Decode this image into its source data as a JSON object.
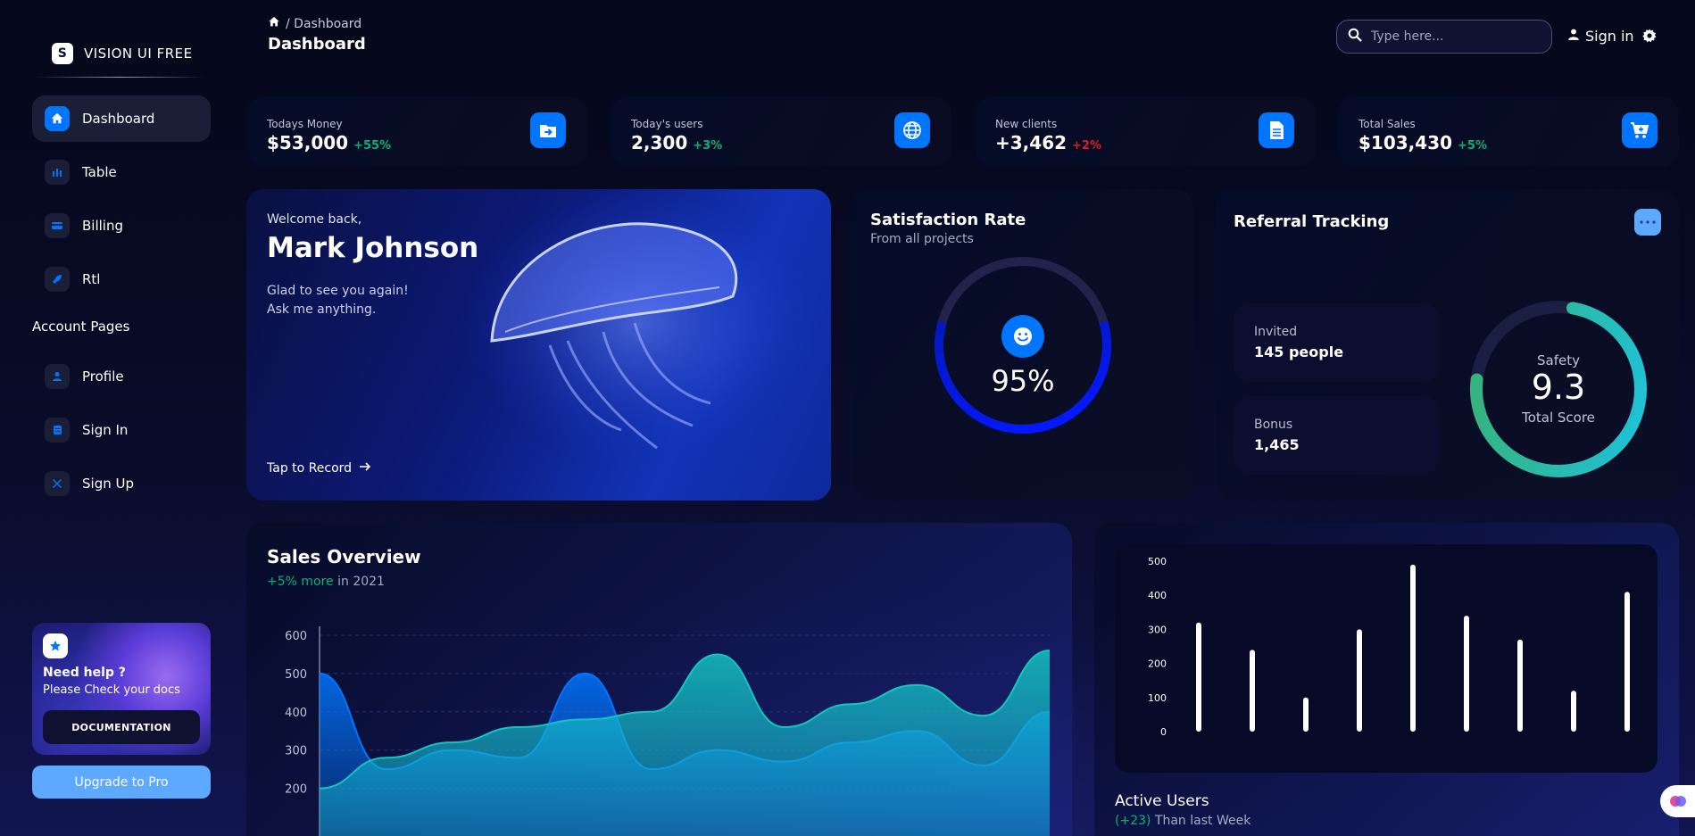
{
  "brand": {
    "name": "VISION UI FREE",
    "logo_letter": "S"
  },
  "sidebar": {
    "items": [
      {
        "label": "Dashboard",
        "icon": "home-icon",
        "active": true
      },
      {
        "label": "Table",
        "icon": "bar-chart-icon"
      },
      {
        "label": "Billing",
        "icon": "credit-card-icon"
      },
      {
        "label": "Rtl",
        "icon": "rocket-icon"
      }
    ],
    "section_title": "Account Pages",
    "account_items": [
      {
        "label": "Profile",
        "icon": "user-icon"
      },
      {
        "label": "Sign In",
        "icon": "document-icon"
      },
      {
        "label": "Sign Up",
        "icon": "tools-icon"
      }
    ],
    "help": {
      "title": "Need help ?",
      "subtitle": "Please Check your docs",
      "button": "DOCUMENTATION"
    },
    "upgrade": "Upgrade to Pro"
  },
  "header": {
    "breadcrumb": "/ Dashboard",
    "title": "Dashboard",
    "search_placeholder": "Type here...",
    "signin": "Sign in"
  },
  "stats": [
    {
      "label": "Todays Money",
      "value": "$53,000",
      "change": "+55%",
      "change_color": "#01b574",
      "icon": "wallet-icon"
    },
    {
      "label": "Today's users",
      "value": "2,300",
      "change": "+3%",
      "change_color": "#01b574",
      "icon": "globe-icon"
    },
    {
      "label": "New clients",
      "value": "+3,462",
      "change": "+2%",
      "change_color": "#e31a1a",
      "icon": "document-icon"
    },
    {
      "label": "Total Sales",
      "value": "$103,430",
      "change": "+5%",
      "change_color": "#01b574",
      "icon": "cart-icon"
    }
  ],
  "welcome": {
    "greeting": "Welcome back,",
    "name": "Mark Johnson",
    "line1": "Glad to see you again!",
    "line2": "Ask me anything.",
    "cta": "Tap to Record"
  },
  "satisfaction": {
    "title": "Satisfaction Rate",
    "subtitle": "From all projects",
    "value": "95%",
    "percent": 0.95
  },
  "referral": {
    "title": "Referral Tracking",
    "invited_label": "Invited",
    "invited_value": "145 people",
    "bonus_label": "Bonus",
    "bonus_value": "1,465",
    "safety_label": "Safety",
    "score": "9.3",
    "score_label": "Total Score",
    "score_fraction": 0.93
  },
  "sales": {
    "title": "Sales Overview",
    "highlight": "+5% more",
    "suffix": "in 2021"
  },
  "active_users": {
    "title": "Active Users",
    "highlight": "(+23)",
    "suffix": "Than last Week"
  },
  "accent": "#0075ff",
  "chart_data": [
    {
      "type": "area",
      "title": "Sales Overview",
      "y_ticks": [
        600,
        500,
        400,
        300,
        200
      ],
      "ylim": [
        200,
        600
      ],
      "series": [
        {
          "values": [
            500,
            250,
            300,
            280,
            500,
            250,
            300,
            270,
            320,
            350,
            260,
            400
          ],
          "color": "#0075ff"
        },
        {
          "values": [
            200,
            280,
            320,
            360,
            380,
            400,
            550,
            360,
            420,
            470,
            390,
            560
          ],
          "color": "#14c4c0"
        }
      ]
    },
    {
      "type": "bar",
      "title": "Active Users",
      "y_ticks": [
        500,
        400,
        300,
        200,
        100,
        0
      ],
      "ylim": [
        0,
        500
      ],
      "values": [
        320,
        240,
        100,
        300,
        490,
        340,
        270,
        120,
        410
      ]
    }
  ]
}
